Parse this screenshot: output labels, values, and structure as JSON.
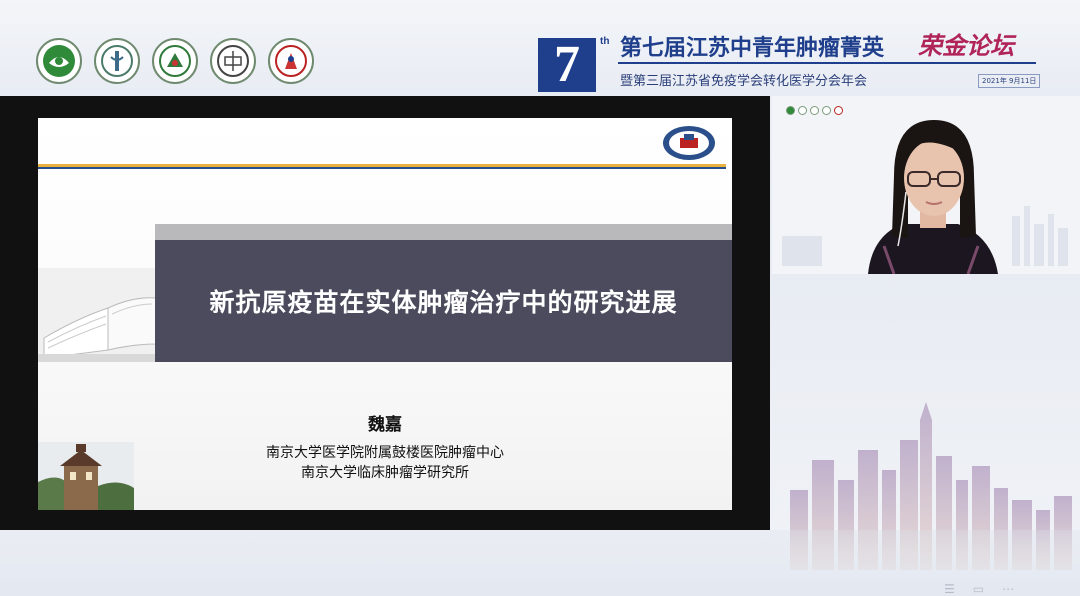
{
  "banner": {
    "badge_number": "7",
    "badge_suffix": "th",
    "title": "第七届江苏中青年肿瘤菁英",
    "title_script": "荣金论坛",
    "subtitle": "暨第三届江苏省免疫学会转化医学分会年会",
    "date": "2021年 9月11日",
    "logos": [
      "logo-1-icon",
      "logo-2-icon",
      "logo-3-icon",
      "logo-4-icon",
      "logo-5-icon"
    ]
  },
  "slide": {
    "title": "新抗原疫苗在实体肿瘤治疗中的研究进展",
    "presenter": "魏嘉",
    "affiliation_1": "南京大学医学院附属鼓楼医院肿瘤中心",
    "affiliation_2": "南京大学临床肿瘤学研究所"
  },
  "colors": {
    "brand_blue": "#1f3f8c",
    "script_red": "#b0245a",
    "title_band": "#4b4b5d",
    "accent_gold": "#e6b23d"
  }
}
